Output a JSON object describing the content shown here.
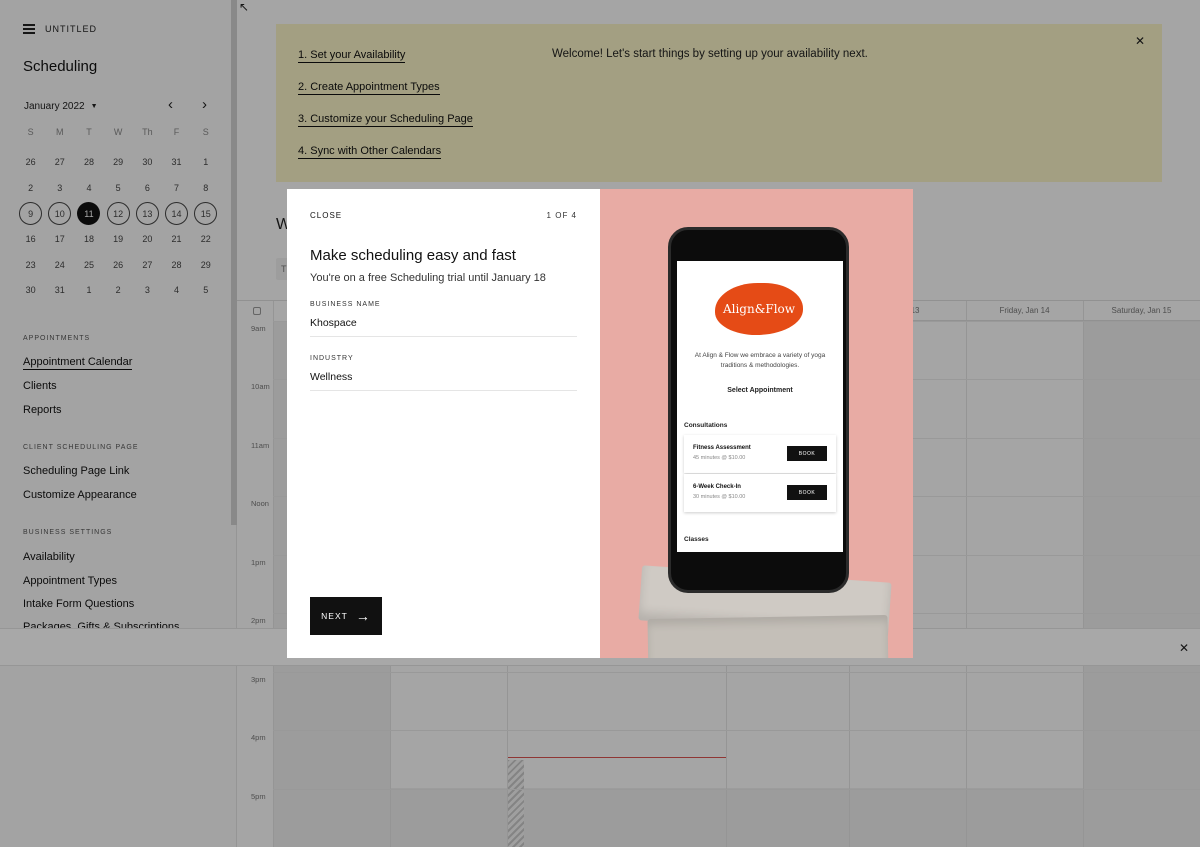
{
  "sidebar": {
    "site_name": "UNTITLED",
    "panel_title": "Scheduling",
    "mini_calendar": {
      "month_label": "January 2022",
      "weekdays": [
        "S",
        "M",
        "T",
        "W",
        "Th",
        "F",
        "S"
      ],
      "weeks": [
        [
          "26",
          "27",
          "28",
          "29",
          "30",
          "31",
          "1"
        ],
        [
          "2",
          "3",
          "4",
          "5",
          "6",
          "7",
          "8"
        ],
        [
          "9",
          "10",
          "11",
          "12",
          "13",
          "14",
          "15"
        ],
        [
          "16",
          "17",
          "18",
          "19",
          "20",
          "21",
          "22"
        ],
        [
          "23",
          "24",
          "25",
          "26",
          "27",
          "28",
          "29"
        ],
        [
          "30",
          "31",
          "1",
          "2",
          "3",
          "4",
          "5"
        ]
      ],
      "selected_week_index": 2,
      "today": "11"
    },
    "sections": {
      "appointments": "APPOINTMENTS",
      "client_page": "CLIENT SCHEDULING PAGE",
      "business": "BUSINESS SETTINGS"
    },
    "items": {
      "appointment_calendar": "Appointment Calendar",
      "clients": "Clients",
      "reports": "Reports",
      "scheduling_page_link": "Scheduling Page Link",
      "customize_appearance": "Customize Appearance",
      "availability": "Availability",
      "appointment_types": "Appointment Types",
      "intake_form_questions": "Intake Form Questions",
      "packages": "Packages, Gifts & Subscriptions"
    }
  },
  "banner": {
    "steps": [
      "1. Set your Availability",
      "2. Create Appointment Types",
      "3. Customize your Scheduling Page",
      "4. Sync with Other Calendars"
    ],
    "welcome": "Welcome! Let's start things by setting up your availability next."
  },
  "main": {
    "week_title_initial": "W",
    "view_chip_initial": "T",
    "day_headers": [
      "Jan 13",
      "Friday, Jan 14",
      "Saturday, Jan 15"
    ],
    "times": [
      "9am",
      "10am",
      "11am",
      "Noon",
      "1pm",
      "2pm",
      "3pm",
      "4pm",
      "5pm"
    ]
  },
  "modal": {
    "close_label": "CLOSE",
    "counter": "1 OF 4",
    "headline": "Make scheduling easy and fast",
    "subline": "You're on a free Scheduling trial until January 18",
    "business_name_label": "BUSINESS NAME",
    "business_name_value": "Khospace",
    "industry_label": "INDUSTRY",
    "industry_value": "Wellness",
    "next_label": "NEXT"
  },
  "phone_preview": {
    "brand": "Align&Flow",
    "tagline": "At Align & Flow we embrace a variety of yoga traditions & methodologies.",
    "select_label": "Select Appointment",
    "consultations_label": "Consultations",
    "cards": [
      {
        "name": "Fitness Assessment",
        "meta": "45 minutes @ $10.00",
        "button": "BOOK"
      },
      {
        "name": "6-Week Check-In",
        "meta": "30 minutes @ $10.00",
        "button": "BOOK"
      }
    ],
    "classes_label": "Classes"
  },
  "colors": {
    "banner_bg": "#f7f2c5",
    "modal_art_bg": "#e8aba4",
    "brand_orange": "#e54b16",
    "now_line": "#d9534f"
  },
  "icons": {
    "menu": "hamburger-icon",
    "close": "close-icon",
    "prev": "chevron-left-icon",
    "next": "chevron-right-icon",
    "next_arrow": "arrow-right-icon",
    "collapse": "arrow-up-left-icon"
  }
}
